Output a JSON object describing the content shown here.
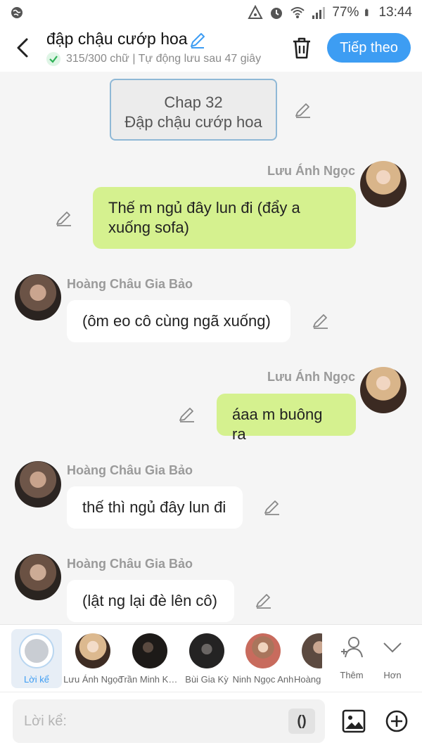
{
  "status_bar": {
    "battery": "77%",
    "time": "13:44"
  },
  "header": {
    "title": "đập chậu cướp hoa",
    "subtitle": "315/300 chữ | Tự động lưu sau 47 giây",
    "next_label": "Tiếp theo"
  },
  "chapter_card": {
    "line1": "Chap 32",
    "line2": "Đập chậu cướp hoa"
  },
  "messages": [
    {
      "side": "right",
      "name": "Lưu Ánh Ngọc",
      "text": "Thế m ngủ đây lun đi (đẩy a xuống sofa)"
    },
    {
      "side": "left",
      "name": "Hoàng Châu Gia Bảo",
      "text": "(ôm eo cô cùng ngã xuống)"
    },
    {
      "side": "right",
      "name": "Lưu Ánh Ngọc",
      "text": "áaa m buông ra"
    },
    {
      "side": "left",
      "name": "Hoàng Châu Gia Bảo",
      "text": "thế thì ngủ đây lun đi"
    },
    {
      "side": "left",
      "name": "Hoàng Châu Gia Bảo",
      "text": "(lật ng lại đè lên cô)"
    }
  ],
  "characters": [
    {
      "label": "Lời kể",
      "active": true
    },
    {
      "label": "Lưu Ánh Ngọc"
    },
    {
      "label": "Trần Minh Khang"
    },
    {
      "label": "Bùi Gia Kỳ"
    },
    {
      "label": "Ninh Ngọc Anh"
    },
    {
      "label": "Hoàng Châu Gia Bảo"
    }
  ],
  "char_actions": {
    "add_label": "Thêm",
    "more_label": "Hơn"
  },
  "input": {
    "placeholder": "Lời kể:",
    "paren_label": "()"
  },
  "colors": {
    "accent": "#3d9df3",
    "bubble_right": "#d5f18f",
    "bubble_left": "#ffffff"
  }
}
